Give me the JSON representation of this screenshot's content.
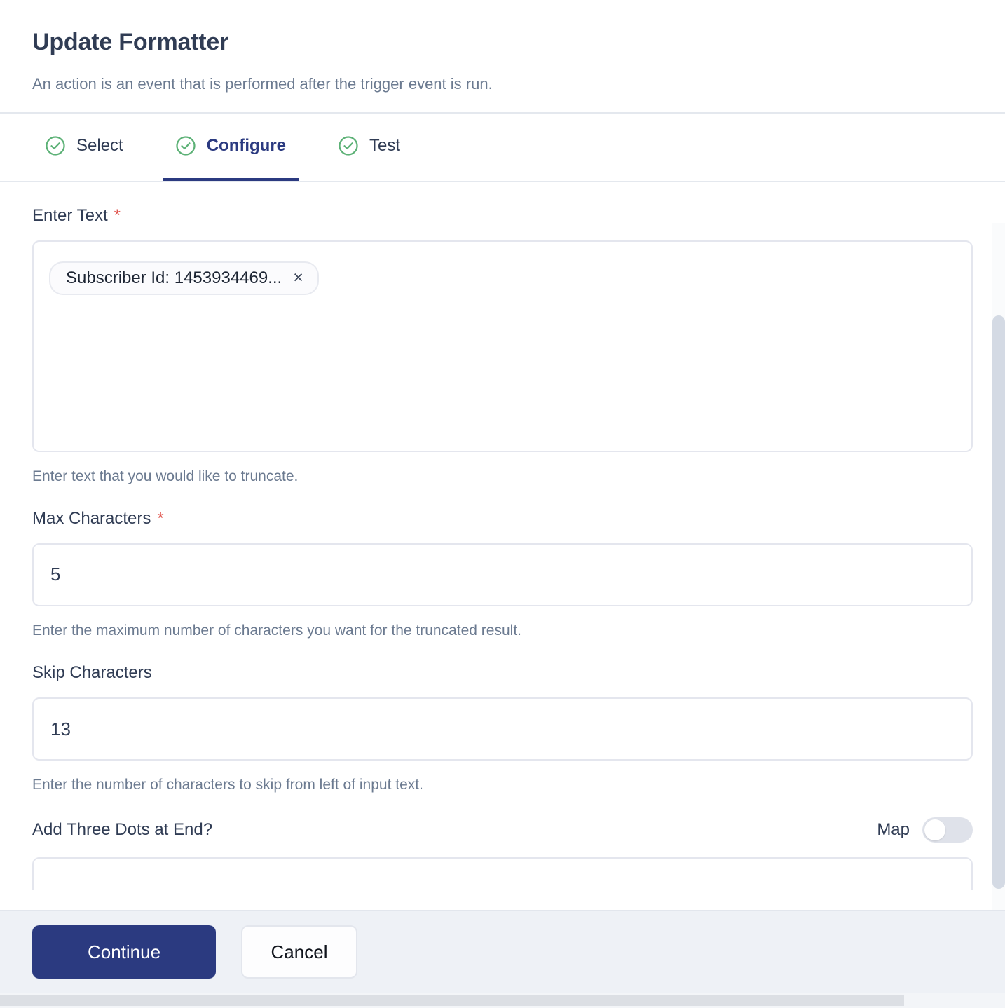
{
  "header": {
    "title": "Update Formatter",
    "subtitle": "An action is an event that is performed after the trigger event is run."
  },
  "tabs": [
    {
      "label": "Select",
      "icon": "check-circle-icon",
      "active": false,
      "complete": true
    },
    {
      "label": "Configure",
      "icon": "check-circle-icon",
      "active": true,
      "complete": true
    },
    {
      "label": "Test",
      "icon": "check-circle-icon",
      "active": false,
      "complete": true
    }
  ],
  "fields": {
    "enter_text": {
      "label": "Enter Text",
      "required_marker": "*",
      "chip_text": "Subscriber Id: 1453934469...",
      "chip_remove_icon": "×",
      "helper": "Enter text that you would like to truncate."
    },
    "max_characters": {
      "label": "Max Characters",
      "required_marker": "*",
      "value": "5",
      "helper": "Enter the maximum number of characters you want for the truncated result."
    },
    "skip_characters": {
      "label": "Skip Characters",
      "value": "13",
      "helper": "Enter the number of characters to skip from left of input text."
    },
    "add_three_dots": {
      "label": "Add Three Dots at End?",
      "map_label": "Map",
      "map_enabled": false
    }
  },
  "footer": {
    "continue_label": "Continue",
    "cancel_label": "Cancel"
  },
  "colors": {
    "primary": "#2b3a80",
    "success": "#5cb176",
    "required": "#e0564f",
    "text": "#303c54",
    "muted": "#6b7a90",
    "footer_bg": "#eef1f6"
  }
}
